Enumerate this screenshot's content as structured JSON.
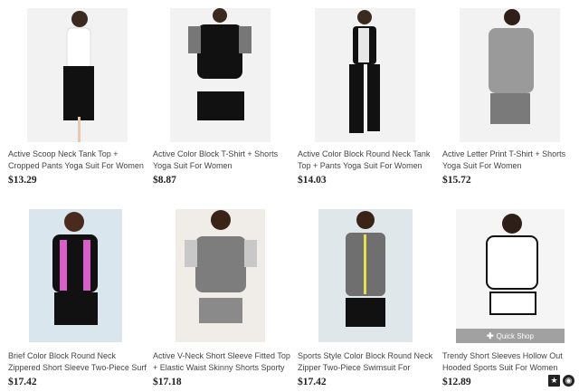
{
  "products": [
    {
      "title": "Active Scoop Neck Tank Top + Cropped Pants Yoga Suit For Women",
      "price": "$13.29"
    },
    {
      "title": "Active Color Block T-Shirt + Shorts Yoga Suit For Women",
      "price": "$8.87"
    },
    {
      "title": "Active Color Block Round Neck Tank Top + Pants Yoga Suit For Women",
      "price": "$14.03"
    },
    {
      "title": "Active Letter Print T-Shirt + Shorts Yoga Suit For Women",
      "price": "$15.72"
    },
    {
      "title": "Brief Color Block Round Neck Zippered Short Sleeve Two-Piece Surf",
      "price": "$17.42"
    },
    {
      "title": "Active V-Neck Short Sleeve Fitted Top + Elastic Waist Skinny Shorts Sporty",
      "price": "$17.18"
    },
    {
      "title": "Sports Style Color Block Round Neck Zipper Two-Piece Swimsuit For",
      "price": "$17.42"
    },
    {
      "title": "Trendy Short Sleeves Hollow Out Hooded Sports Suit For Women",
      "price": "$12.89"
    }
  ],
  "quick_shop": {
    "label": "Quick Shop",
    "icon": "plus-icon"
  },
  "corner_icons": [
    "star-icon",
    "circle-icon"
  ]
}
